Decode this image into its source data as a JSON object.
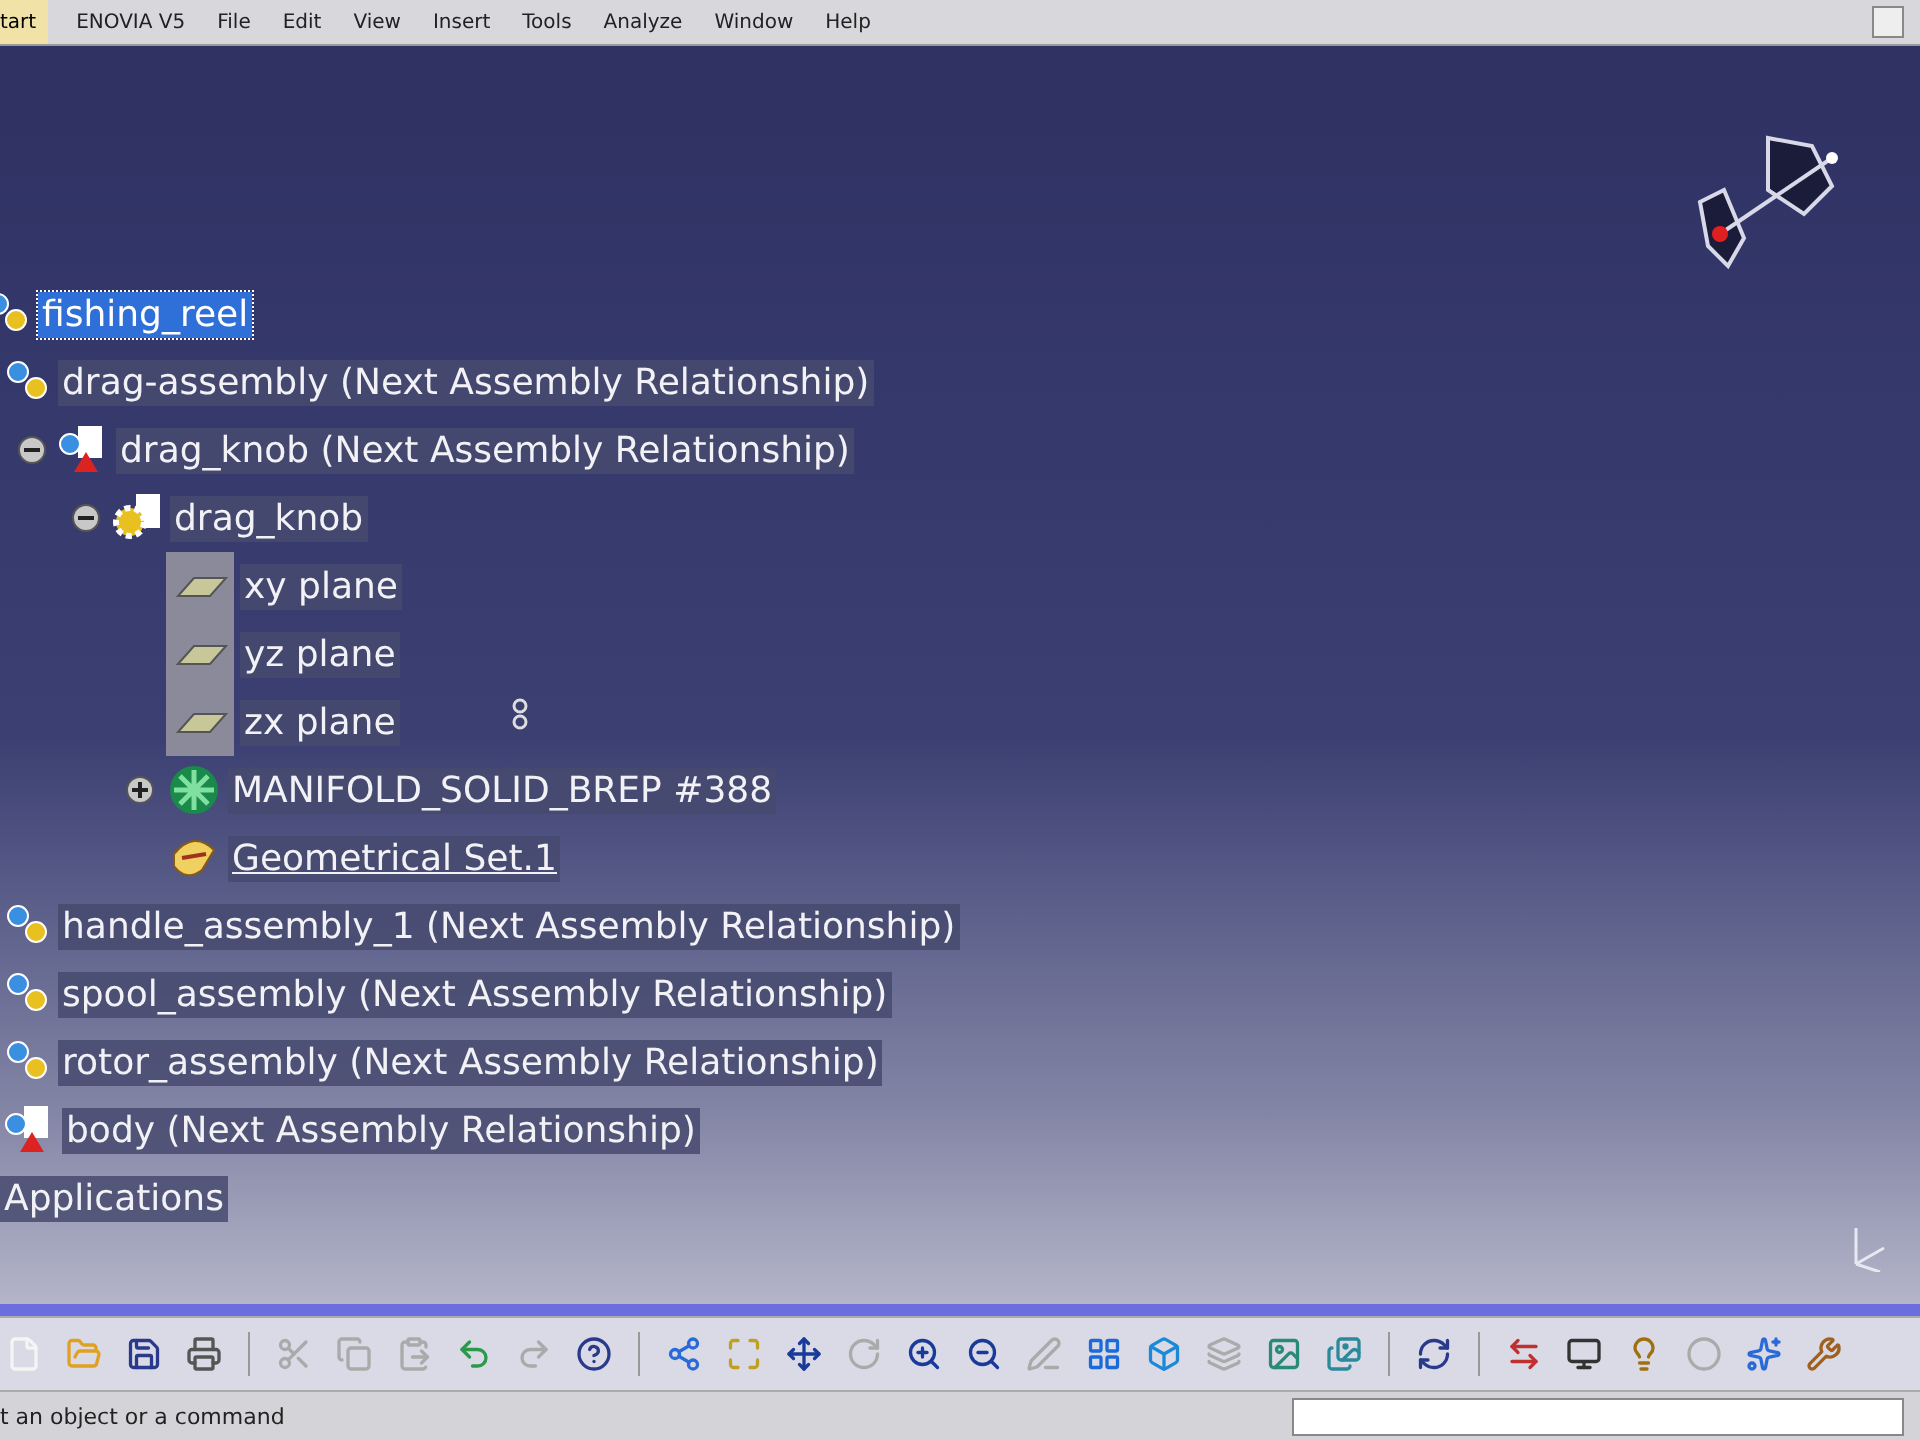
{
  "menu_bar": {
    "start": "tart",
    "items": [
      "ENOVIA V5",
      "File",
      "Edit",
      "View",
      "Insert",
      "Tools",
      "Analyze",
      "Window",
      "Help"
    ]
  },
  "tree": [
    {
      "label": "fishing_reel",
      "kind": "product",
      "selected": true,
      "underlined": false,
      "children": [
        {
          "label": "drag-assembly (Next Assembly Relationship)",
          "kind": "product",
          "selected": false,
          "underlined": false,
          "children": [
            {
              "label": "drag_knob (Next Assembly Relationship)",
              "kind": "part-product",
              "selected": false,
              "underlined": false,
              "expanded": true,
              "children": [
                {
                  "label": "drag_knob",
                  "kind": "part",
                  "selected": false,
                  "underlined": false,
                  "expanded": true,
                  "children": [
                    {
                      "label": "xy plane",
                      "kind": "plane",
                      "selected": false,
                      "underlined": false
                    },
                    {
                      "label": "yz plane",
                      "kind": "plane",
                      "selected": false,
                      "underlined": false
                    },
                    {
                      "label": "zx plane",
                      "kind": "plane",
                      "selected": false,
                      "underlined": false
                    },
                    {
                      "label": "MANIFOLD_SOLID_BREP #388",
                      "kind": "body",
                      "selected": false,
                      "underlined": false,
                      "expanded": false
                    },
                    {
                      "label": "Geometrical Set.1",
                      "kind": "geoset",
                      "selected": false,
                      "underlined": true
                    }
                  ]
                }
              ]
            }
          ]
        },
        {
          "label": "handle_assembly_1 (Next Assembly Relationship)",
          "kind": "product",
          "selected": false,
          "underlined": false
        },
        {
          "label": "spool_assembly (Next Assembly Relationship)",
          "kind": "product",
          "selected": false,
          "underlined": false
        },
        {
          "label": "rotor_assembly (Next Assembly Relationship)",
          "kind": "product",
          "selected": false,
          "underlined": false
        },
        {
          "label": "body (Next Assembly Relationship)",
          "kind": "part-product",
          "selected": false,
          "underlined": false
        }
      ]
    },
    {
      "label": "Applications",
      "selected": false,
      "underlined": false
    }
  ],
  "status_bar": {
    "prompt": "t an object or a command"
  }
}
